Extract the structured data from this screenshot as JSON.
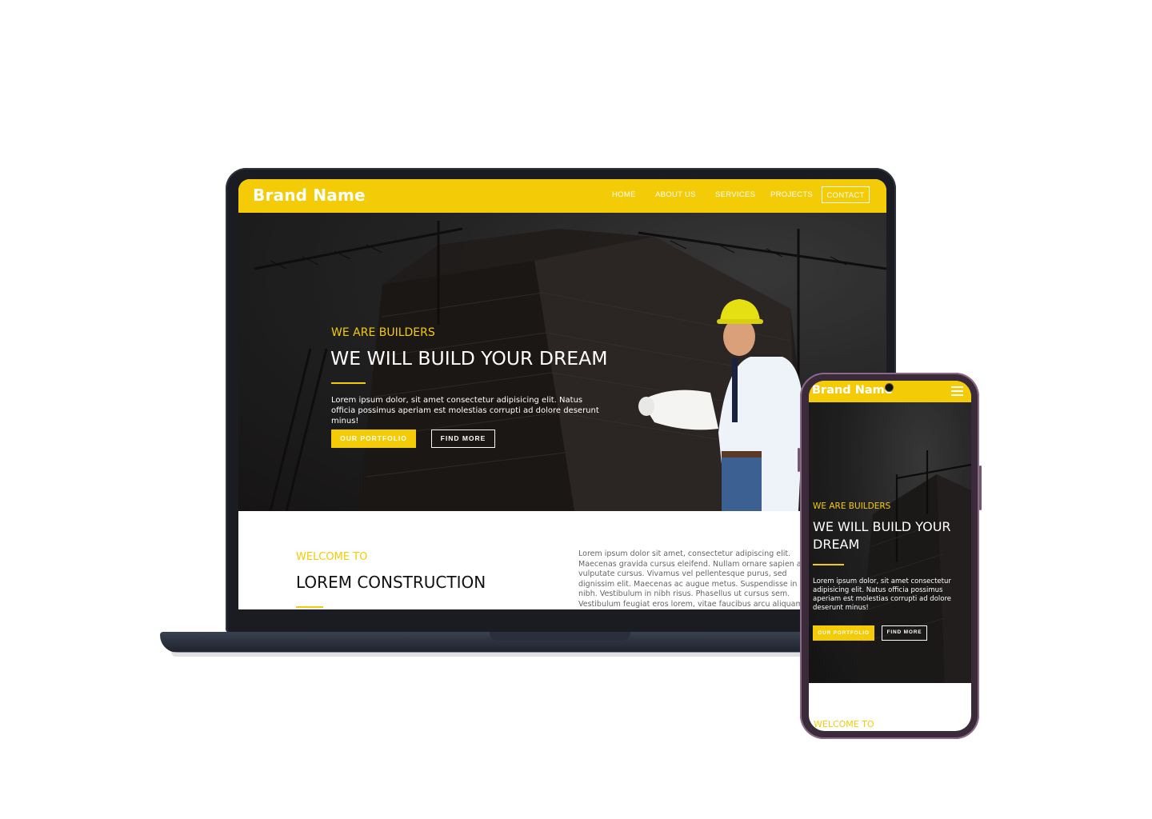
{
  "brand": {
    "name": "Brand Name"
  },
  "nav": {
    "items": [
      "HOME",
      "ABOUT US",
      "SERVICES",
      "PROJECTS"
    ],
    "contact": "CONTACT"
  },
  "hero": {
    "subtitle": "WE ARE BUILDERS",
    "title": "WE WILL BUILD YOUR DREAM",
    "text": "Lorem ipsum dolor, sit amet consectetur adipisicing elit. Natus officia possimus aperiam est molestias corrupti ad dolore deserunt minus!",
    "primary_button": "OUR PORTFOLIO",
    "secondary_button": "FIND MORE"
  },
  "welcome": {
    "label": "WELCOME TO",
    "title": "LOREM CONSTRUCTION",
    "text": "Lorem ipsum dolor sit amet, consectetur adipiscing elit. Maecenas gravida cursus eleifend. Nullam ornare sapien ac vulputate cursus. Vivamus vel pellentesque purus, sed dignissim elit. Maecenas ac augue metus. Suspendisse in elit nibh. Vestibulum in nibh risus. Phasellus ut cursus sem. Vestibulum feugiat eros lorem, vitae faucibus arcu aliquam ac. Sed tempus"
  },
  "mobile": {
    "brand": "Brand Name",
    "subtitle": "WE ARE BUILDERS",
    "title": "WE WILL BUILD YOUR DREAM",
    "text": "Lorem ipsum dolor, sit amet consectetur adipisicing elit. Natus officia possimus aperiam est molestias corrupti ad dolore deserunt minus!",
    "primary_button": "OUR PORTFOLIO",
    "secondary_button": "FIND MORE",
    "welcome": "WELCOME TO"
  },
  "colors": {
    "accent": "#f3cb06",
    "dark": "#1a1c22",
    "text": "#111111"
  },
  "icons": {
    "menu": "hamburger-menu-icon"
  }
}
